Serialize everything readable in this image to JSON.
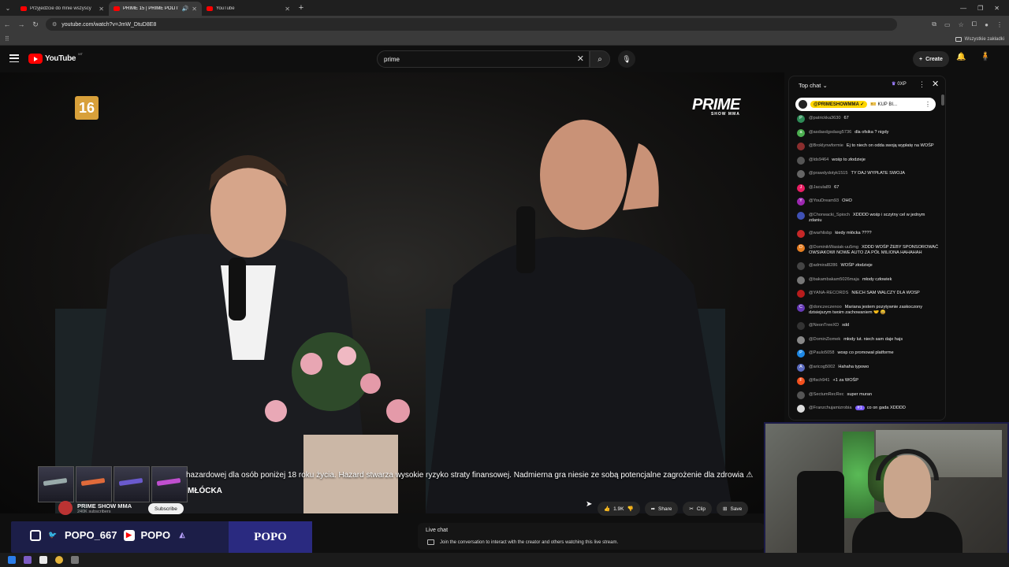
{
  "browser": {
    "tabs": [
      {
        "title": "Przyjedźcie do mnie wszyscy",
        "active": false
      },
      {
        "title": "PRIME 15 | PRIME POLITYC",
        "active": true
      },
      {
        "title": "YouTube",
        "active": false
      }
    ],
    "url": "youtube.com/watch?v=JmW_DtuD8E8",
    "bookmarks_all": "Wszystkie zakładki"
  },
  "youtube": {
    "logo_text": "YouTube",
    "logo_country": "MT",
    "search_value": "prime",
    "create_label": "Create"
  },
  "video": {
    "age_rating": "16",
    "brand_logo": "PRIME",
    "brand_sub": "SHOW MMA",
    "disclaimer": "hazardowej dla osób poniżej 18 roku życia. Hazard stwarza wysokie ryzyko straty finansowej. Nadmierna gra niesie ze sobą potencjalne zagrożenie dla zdrowia ⚠",
    "caption_name": "MŁÓCKA"
  },
  "channel": {
    "name": "PRIME SHOW MMA",
    "subscribers": "240K subscribers",
    "subscribe_label": "Subscribe"
  },
  "actions": {
    "likes": "1.9K",
    "share": "Share",
    "clip": "Clip",
    "save": "Save"
  },
  "live_chat_bar": {
    "title": "Live chat",
    "text": "Join the conversation to interact with the creator and others watching this live stream."
  },
  "social": {
    "handle1": "POPO_667",
    "handle2": "POPO",
    "logo": "POPO"
  },
  "chat": {
    "mode": "Top chat",
    "xp": "0XP",
    "pinned_user": "@PRIMESHOWMMA ✓",
    "pinned_text": "🎫 KUP BI...",
    "messages": [
      {
        "user": "@patrickka3630",
        "text": "67",
        "color": "#2e8b57",
        "initial": "P"
      },
      {
        "user": "@asdasdgsdasg5736",
        "text": "dla ofsika ? nigdy",
        "color": "#4caf50",
        "initial": "a"
      },
      {
        "user": "@Broklynwformie",
        "text": "Ej to niech on odda swoją wypłatę na WOŚP",
        "color": "#8b2e2e",
        "initial": ""
      },
      {
        "user": "@lds9464",
        "text": "wośp to złodzieje",
        "color": "#555555",
        "initial": ""
      },
      {
        "user": "@prawdydotyk1515",
        "text": "TY DAJ WYPŁATE SWOJA",
        "color": "#666666",
        "initial": ""
      },
      {
        "user": "@Jacula89",
        "text": "67",
        "color": "#e91e63",
        "initial": "J"
      },
      {
        "user": "@YouDream93",
        "text": "OHO",
        "color": "#9c27b0",
        "initial": "Y"
      },
      {
        "user": "@Chorwacki_Spioch",
        "text": "XDDDD wośp i sczytny cel w jednym zdaniu",
        "color": "#3f51b5",
        "initial": ""
      },
      {
        "user": "@warhlisbp",
        "text": "kiedy młócka ????",
        "color": "#c62828",
        "initial": ""
      },
      {
        "user": "@DominikWasiak-uu5mg",
        "text": "XDDD WOŚP ŻEBY SPONSOROWAĆ OWSIAKOWI NOWE AUTO ZA PÓŁ MILIONA HAHAHAH",
        "color": "#e67e22",
        "initial": "D"
      },
      {
        "user": "@admiral8286",
        "text": "WOŚP złodzieje",
        "color": "#444444",
        "initial": ""
      },
      {
        "user": "@bakambakam5026maja",
        "text": "młody człowiek",
        "color": "#777777",
        "initial": ""
      },
      {
        "user": "@YANA-RECORDS",
        "text": "NIECH SAM WALCZY DLA WOSP",
        "color": "#b71c1c",
        "initial": ""
      },
      {
        "user": "@donczeczenoo",
        "text": "Mariana jestem pozytywnie zaskoczony dzisiejszym twoim zachowaniem 🤝 😄",
        "color": "#673ab7",
        "initial": "C"
      },
      {
        "user": "@NeonTreeXD",
        "text": "xdd",
        "color": "#333333",
        "initial": ""
      },
      {
        "user": "@DominZiomek",
        "text": "młody lut. niech sam daje hajs",
        "color": "#888888",
        "initial": ""
      },
      {
        "user": "@Paulo5058",
        "text": "wosp co promował platforme",
        "color": "#1e88e5",
        "initial": "P"
      },
      {
        "user": "@aricog5002",
        "text": "Hahaha typowo",
        "color": "#5c6bc0",
        "initial": "A"
      },
      {
        "user": "@flsch941",
        "text": "+1 za WOŚP",
        "color": "#f4511e",
        "initial": "F"
      },
      {
        "user": "@SectumRecRec",
        "text": "super muran",
        "color": "#555555",
        "initial": ""
      },
      {
        "user": "@Franzchujamizrobia",
        "text": "co on gada XDDDD",
        "color": "#dddddd",
        "initial": "",
        "badge": "#1"
      }
    ]
  }
}
